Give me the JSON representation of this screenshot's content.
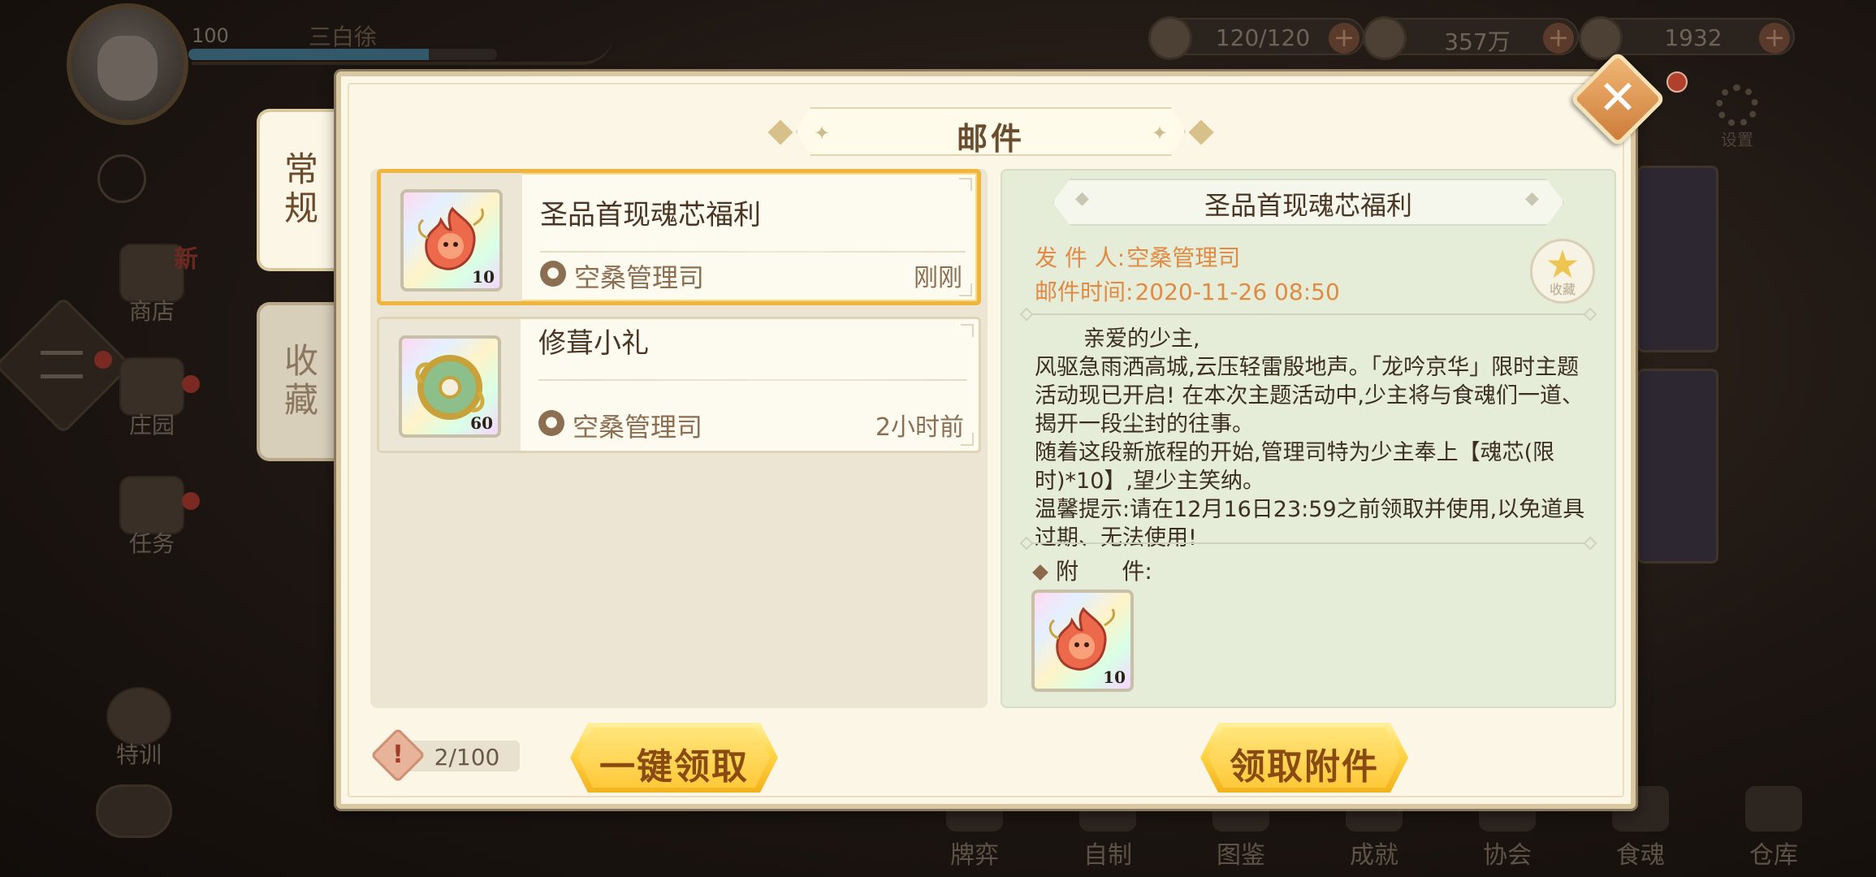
{
  "hud": {
    "level": "100",
    "player_name": "三白徐",
    "exp_fraction": 0.78,
    "resources": [
      {
        "name": "stamina",
        "icon": "bowl-icon",
        "value": "120/120"
      },
      {
        "name": "gold",
        "icon": "feather-icon",
        "value": "357万"
      },
      {
        "name": "jade",
        "icon": "orb-icon",
        "value": "1932"
      }
    ],
    "settings_label": "设置",
    "side": {
      "shop": "商店",
      "shop_badge": "新",
      "manor": "庄园",
      "task": "任务",
      "training": "特训"
    },
    "bottom_nav": [
      "牌弈",
      "自制",
      "图鉴",
      "成就",
      "协会",
      "食魂",
      "仓库"
    ]
  },
  "tabs": {
    "regular": "常规",
    "favorites": "收藏"
  },
  "dialog": {
    "title": "邮件",
    "mails": [
      {
        "subject": "圣品首现魂芯福利",
        "sender": "空桑管理司",
        "time": "刚刚",
        "quantity": "10",
        "icon": "soul-core-flame-icon"
      },
      {
        "subject": "修葺小礼",
        "sender": "空桑管理司",
        "time": "2小时前",
        "quantity": "60",
        "icon": "jade-ring-icon"
      }
    ],
    "detail": {
      "title": "圣品首现魂芯福利",
      "sender_label": "发 件 人:",
      "sender": "空桑管理司",
      "time_label": "邮件时间:",
      "time": "2020-11-26  08:50",
      "favorite_label": "收藏",
      "body": [
        "亲爱的少主,",
        "风驱急雨洒高城,云压轻雷殷地声。「龙吟京华」限时主题活动现已开启! 在本次主题活动中,少主将与食魂们一道、揭开一段尘封的往事。",
        "随着这段新旅程的开始,管理司特为少主奉上【魂芯(限时)*10】,望少主笑纳。",
        "温馨提示:请在12月16日23:59之前领取并使用,以免道具过期、无法使用!"
      ],
      "attachment_label": "附      件:",
      "attachment_quantity": "10"
    },
    "mail_count": "2/100",
    "claim_all": "一键领取",
    "claim_attachment": "领取附件"
  }
}
